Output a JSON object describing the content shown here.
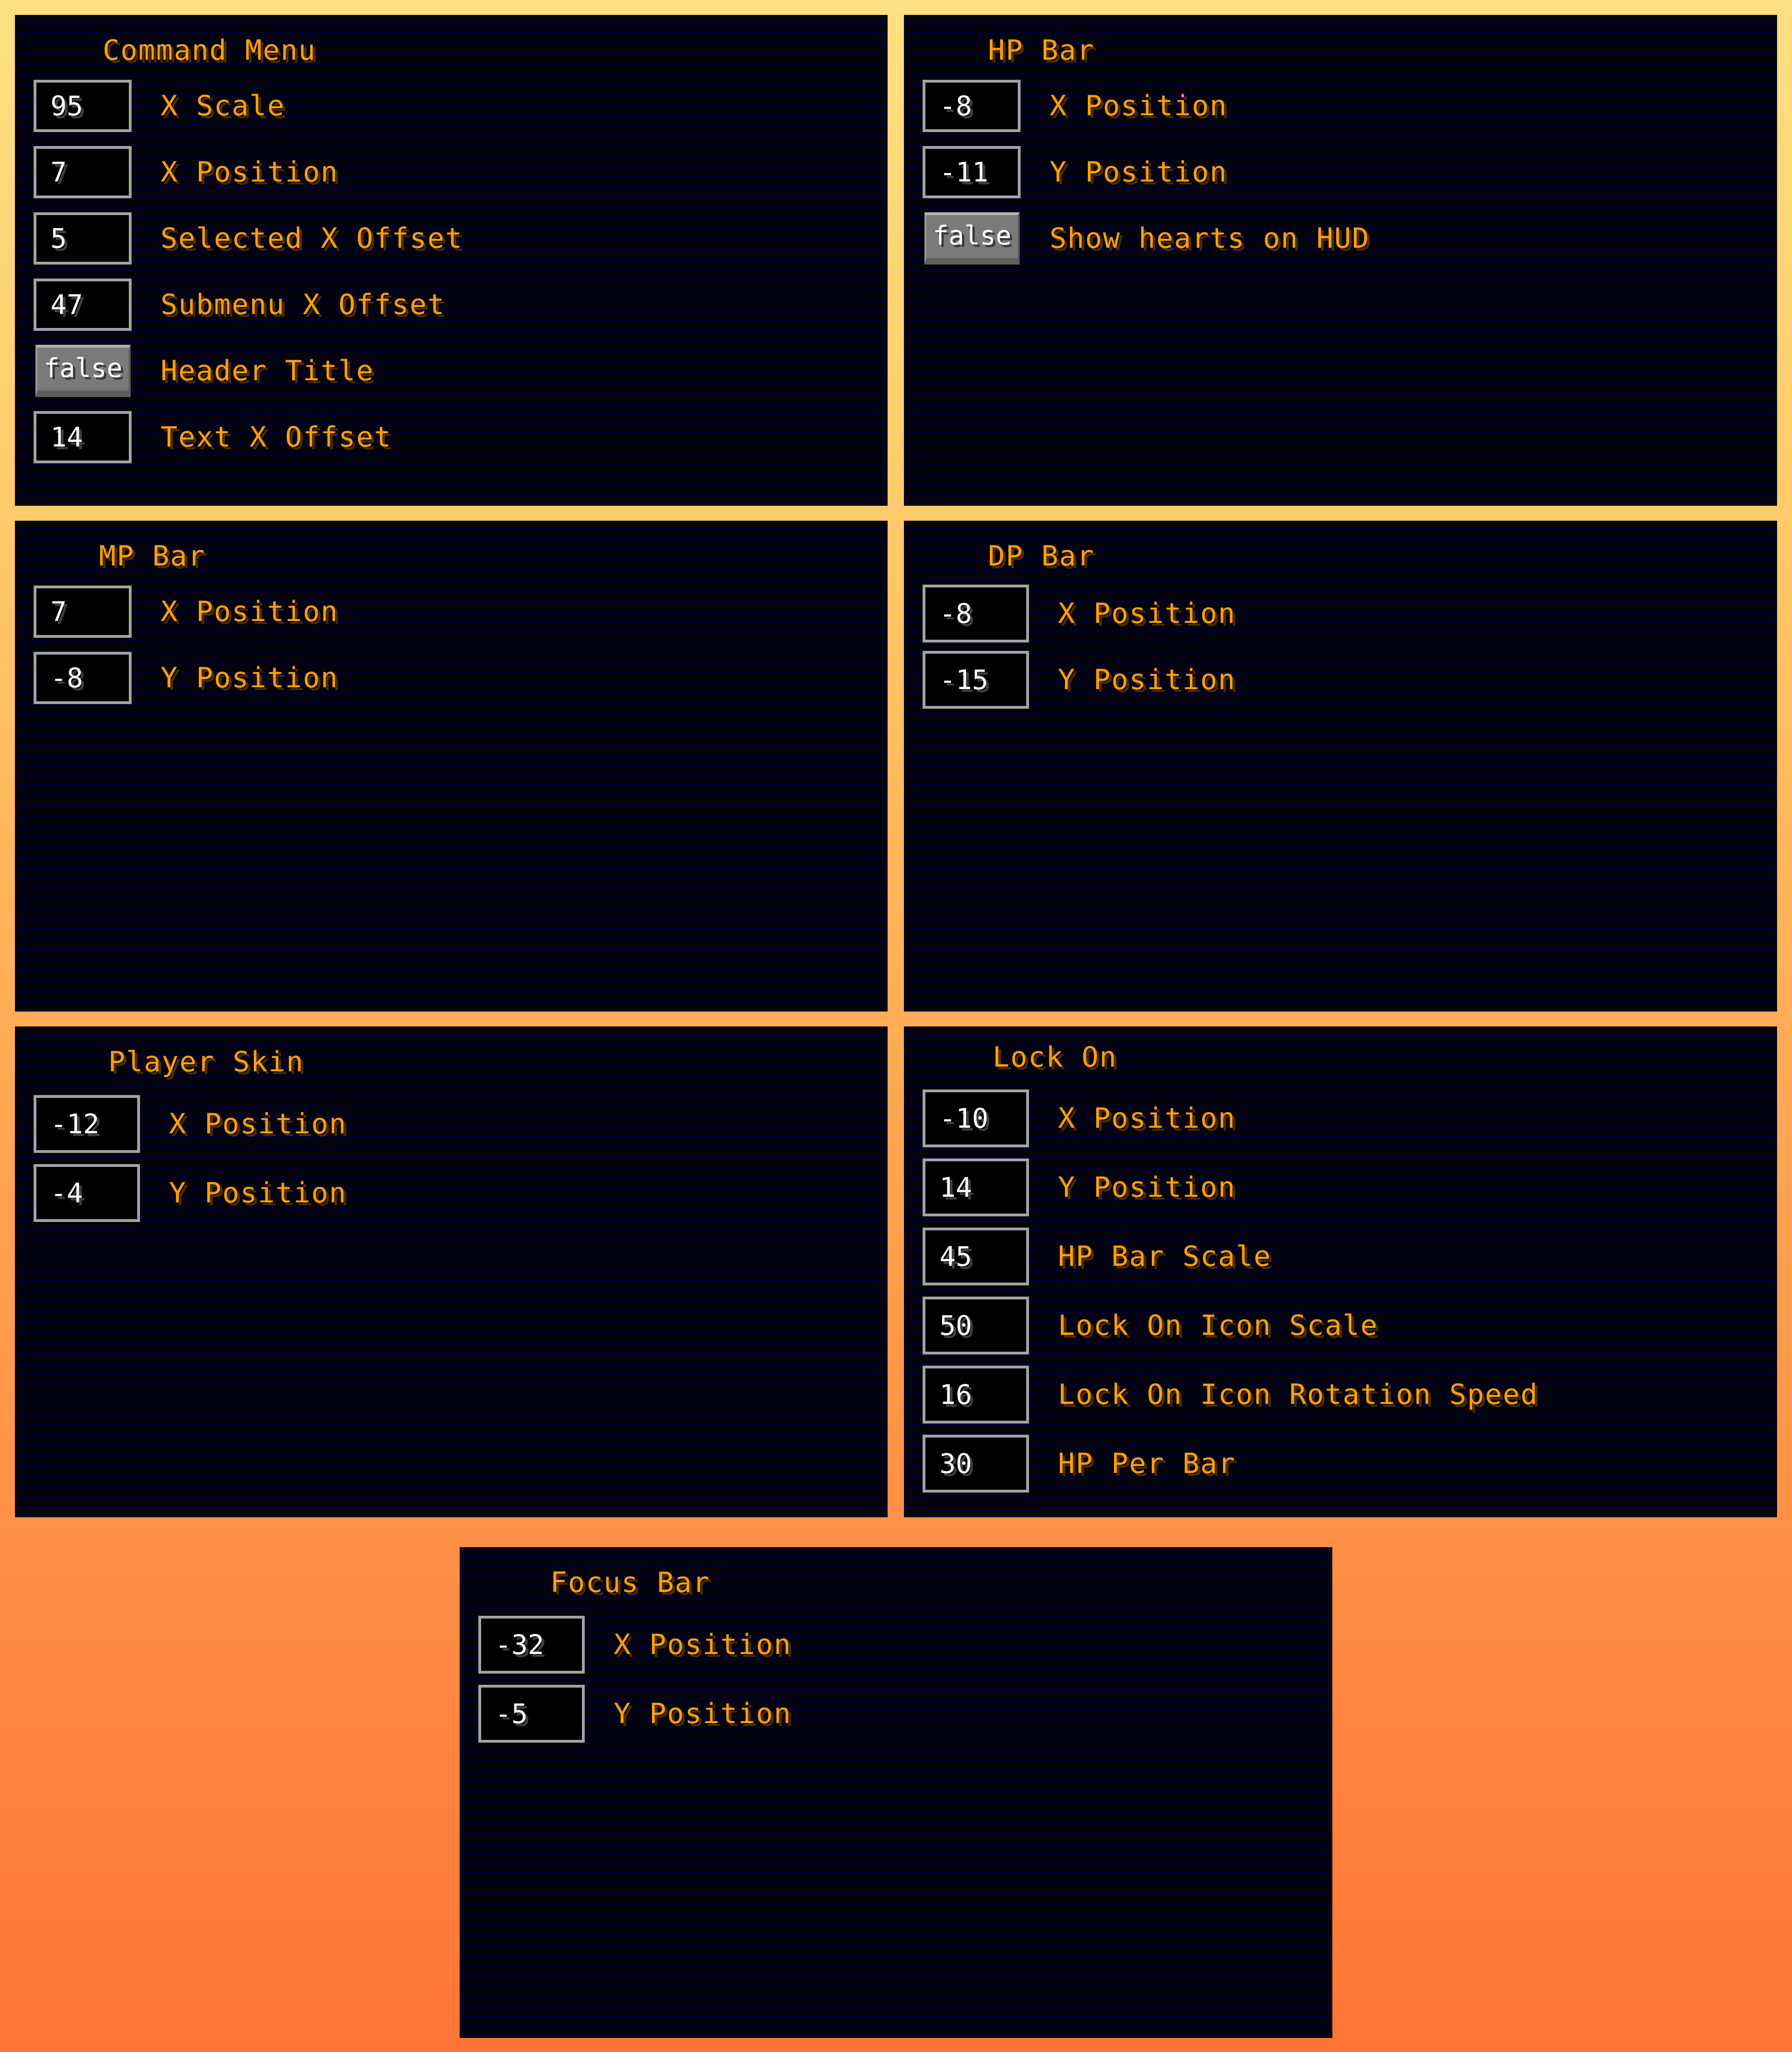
{
  "background": {
    "top_color": "#ffe082",
    "bottom_color": "#ff7433"
  },
  "colors": {
    "panel_bg": "#05050d",
    "scanline": "#010124",
    "label_text": "#ffa00a",
    "label_shadow": "#4a2a05",
    "field_border": "#a3a3a3",
    "field_text": "#ffffff",
    "button_bg": "#7a7a7a"
  },
  "panels": {
    "command_menu": {
      "title": "Command Menu",
      "rows": [
        {
          "type": "number",
          "value": "95",
          "label": "X Scale"
        },
        {
          "type": "number",
          "value": "7",
          "label": "X Position"
        },
        {
          "type": "number",
          "value": "5",
          "label": "Selected X Offset"
        },
        {
          "type": "number",
          "value": "47",
          "label": "Submenu X Offset"
        },
        {
          "type": "toggle",
          "value": "false",
          "label": "Header Title"
        },
        {
          "type": "number",
          "value": "14",
          "label": "Text X Offset"
        }
      ]
    },
    "hp_bar": {
      "title": "HP Bar",
      "rows": [
        {
          "type": "number",
          "value": "-8",
          "label": "X Position"
        },
        {
          "type": "number",
          "value": "-11",
          "label": "Y Position"
        },
        {
          "type": "toggle",
          "value": "false",
          "label": "Show hearts on HUD"
        }
      ]
    },
    "mp_bar": {
      "title": "MP Bar",
      "rows": [
        {
          "type": "number",
          "value": "7",
          "label": "X Position"
        },
        {
          "type": "number",
          "value": "-8",
          "label": "Y Position"
        }
      ]
    },
    "dp_bar": {
      "title": "DP Bar",
      "rows": [
        {
          "type": "number",
          "value": "-8",
          "label": "X Position"
        },
        {
          "type": "number",
          "value": "-15",
          "label": "Y Position"
        }
      ]
    },
    "player_skin": {
      "title": "Player Skin",
      "rows": [
        {
          "type": "number",
          "value": "-12",
          "label": "X Position"
        },
        {
          "type": "number",
          "value": "-4",
          "label": "Y Position"
        }
      ]
    },
    "lock_on": {
      "title": "Lock On",
      "rows": [
        {
          "type": "number",
          "value": "-10",
          "label": "X Position"
        },
        {
          "type": "number",
          "value": "14",
          "label": "Y Position"
        },
        {
          "type": "number",
          "value": "45",
          "label": "HP Bar Scale"
        },
        {
          "type": "number",
          "value": "50",
          "label": "Lock On Icon Scale"
        },
        {
          "type": "number",
          "value": "16",
          "label": "Lock On Icon Rotation Speed"
        },
        {
          "type": "number",
          "value": "30",
          "label": "HP Per Bar"
        }
      ]
    },
    "focus_bar": {
      "title": "Focus Bar",
      "rows": [
        {
          "type": "number",
          "value": "-32",
          "label": "X Position"
        },
        {
          "type": "number",
          "value": "-5",
          "label": "Y Position"
        }
      ]
    }
  }
}
